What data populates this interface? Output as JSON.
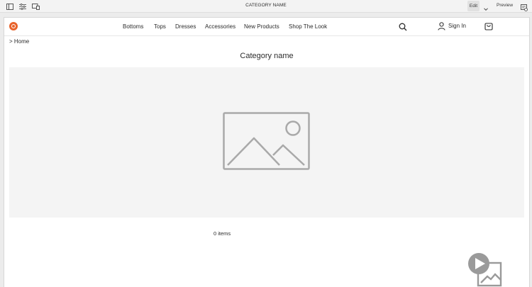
{
  "editor": {
    "title": "CATEGORY NAME",
    "mode_label": "Edit",
    "preview_label": "Preview",
    "icons": [
      "side-panel-icon",
      "properties-icon",
      "emulator-icon",
      "chevron-down-icon",
      "page-information-icon"
    ]
  },
  "header": {
    "nav_items": [
      {
        "label": "Bottoms"
      },
      {
        "label": "Tops"
      },
      {
        "label": "Dresses"
      },
      {
        "label": "Accessories"
      },
      {
        "label": "New Products"
      },
      {
        "label": "Shop The Look"
      }
    ],
    "sign_in_label": "Sign In",
    "brand_color": "#e8632b"
  },
  "breadcrumb": "> Home",
  "category": {
    "title": "Category name",
    "items_count": "0 items"
  }
}
